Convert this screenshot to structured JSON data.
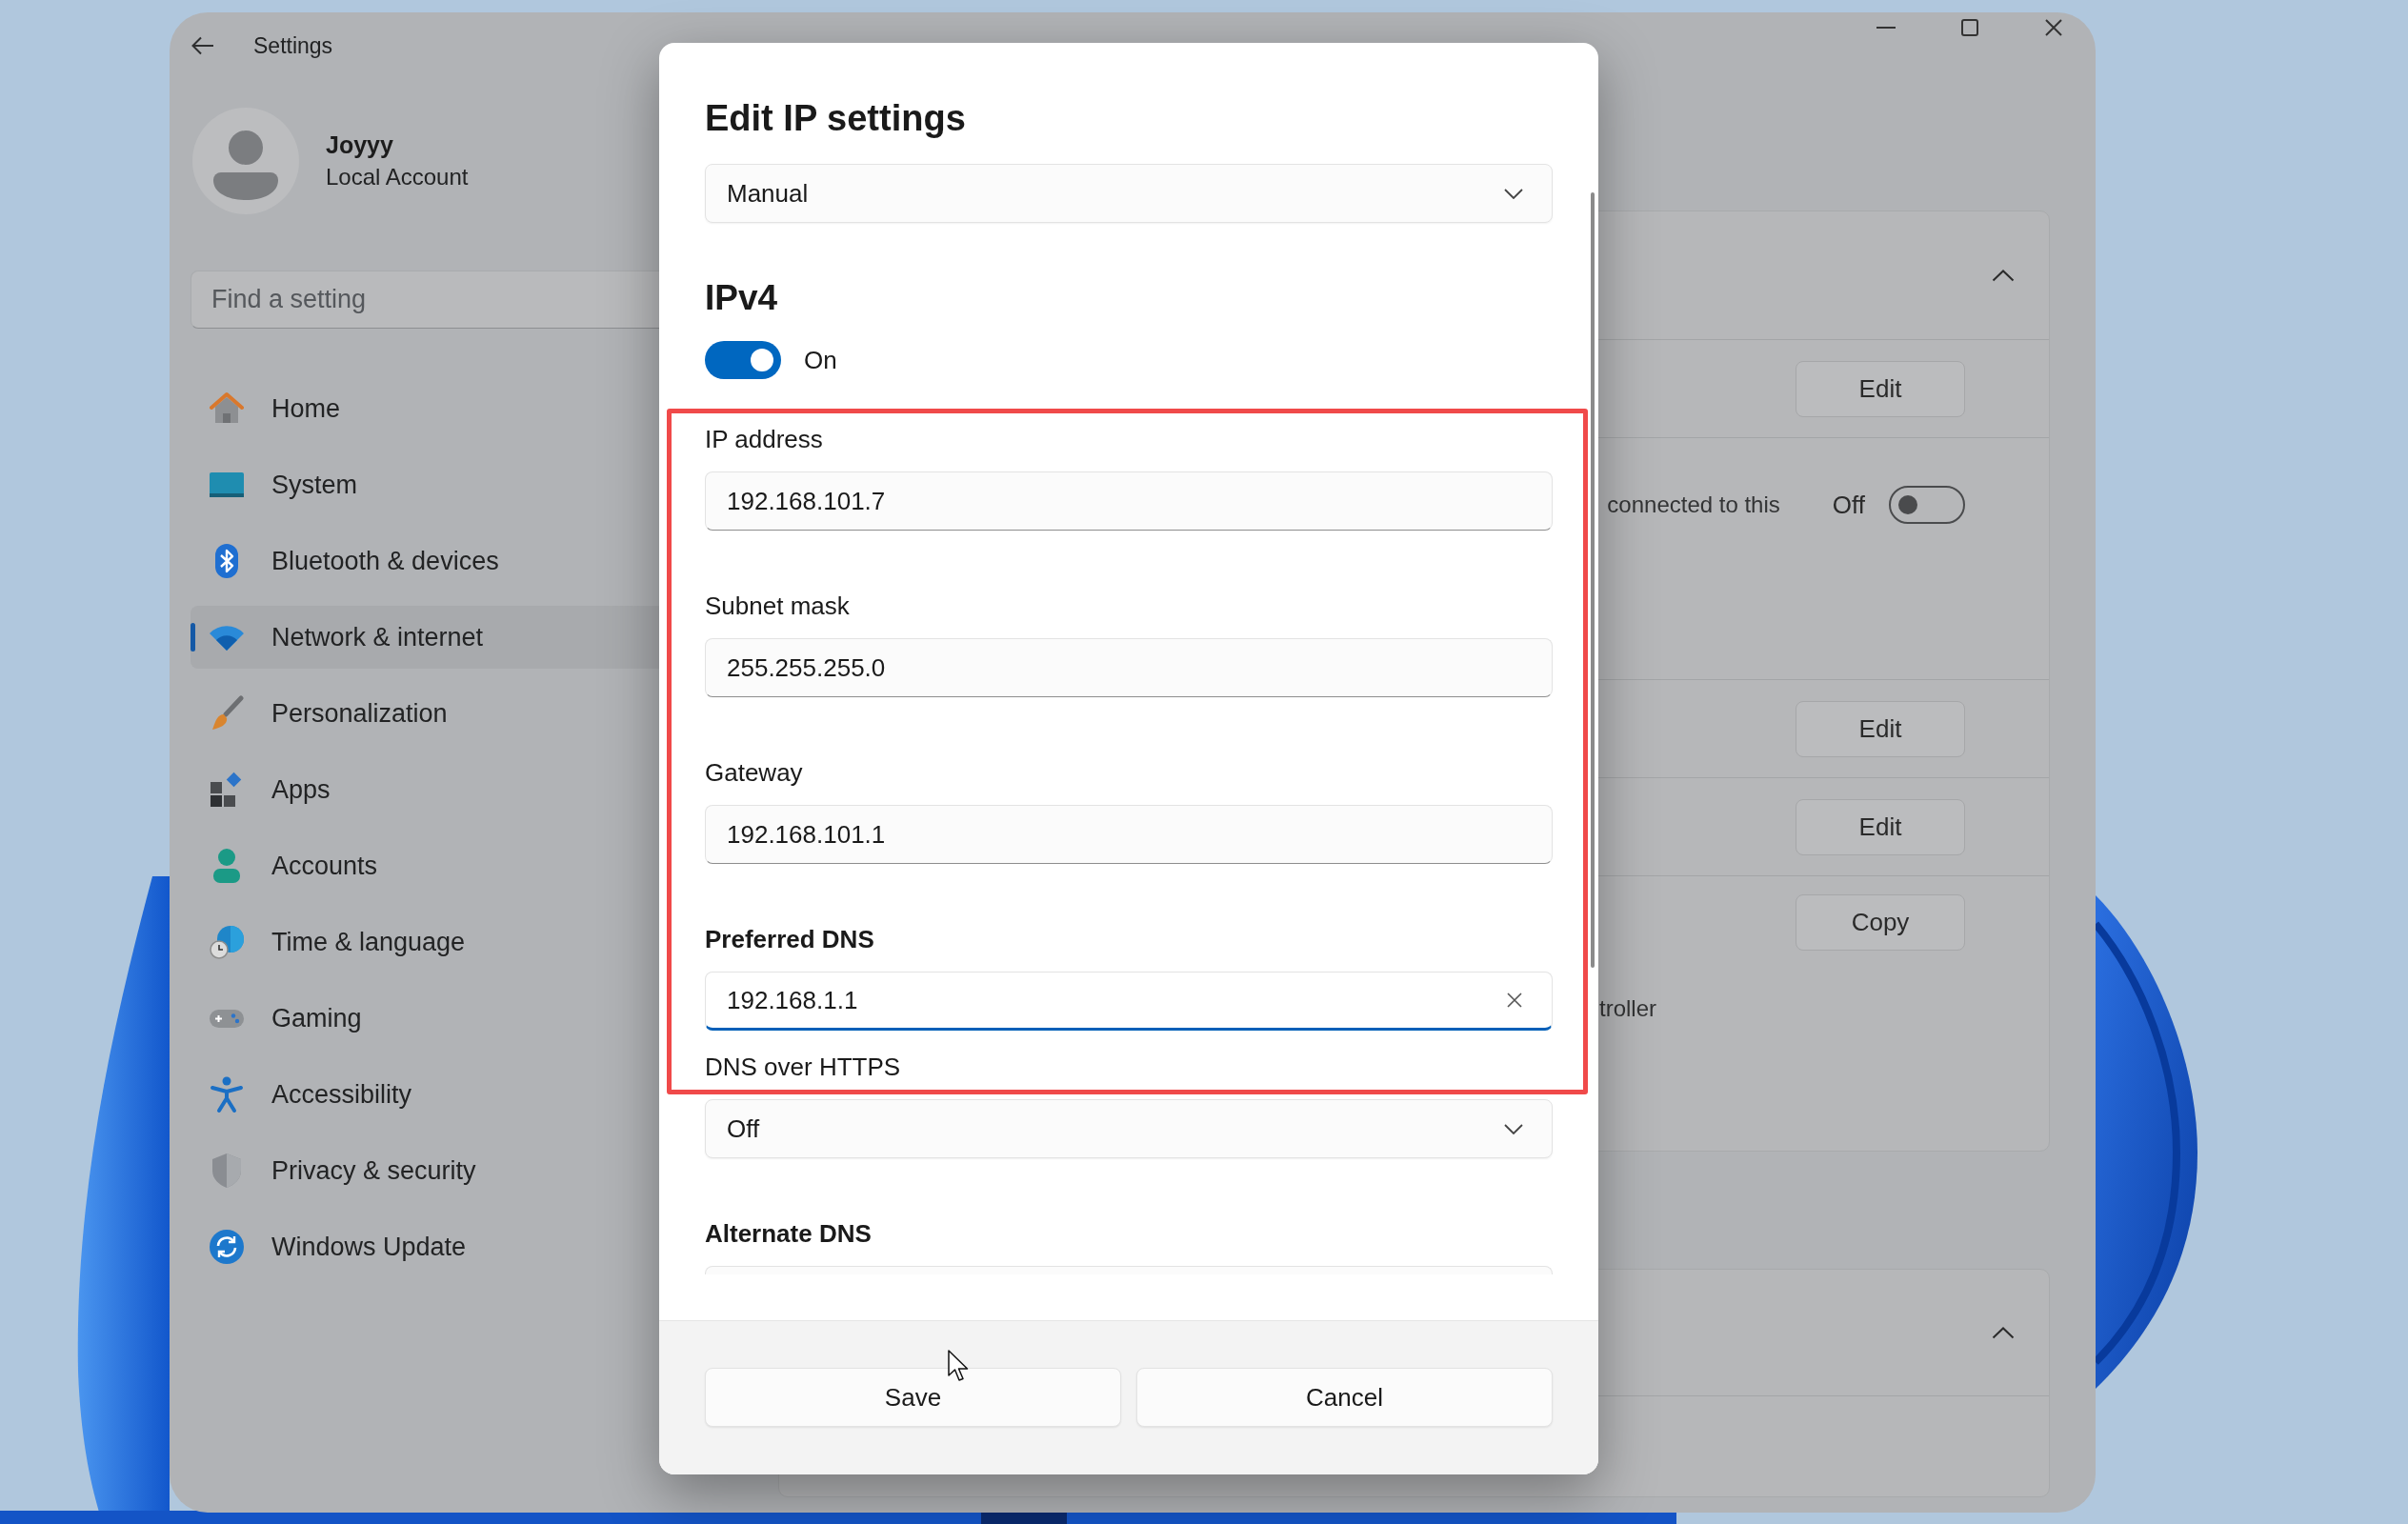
{
  "window": {
    "title": "Settings"
  },
  "profile": {
    "name": "Joyyy",
    "account_type": "Local Account"
  },
  "search": {
    "placeholder": "Find a setting"
  },
  "sidebar": {
    "items": [
      {
        "label": "Home",
        "selected": false
      },
      {
        "label": "System",
        "selected": false
      },
      {
        "label": "Bluetooth & devices",
        "selected": false
      },
      {
        "label": "Network & internet",
        "selected": true
      },
      {
        "label": "Personalization",
        "selected": false
      },
      {
        "label": "Apps",
        "selected": false
      },
      {
        "label": "Accounts",
        "selected": false
      },
      {
        "label": "Time & language",
        "selected": false
      },
      {
        "label": "Gaming",
        "selected": false
      },
      {
        "label": "Accessibility",
        "selected": false
      },
      {
        "label": "Privacy & security",
        "selected": false
      },
      {
        "label": "Windows Update",
        "selected": false
      }
    ]
  },
  "page": {
    "cards": [
      {
        "expanded": true,
        "rows": [
          {
            "kind": "button",
            "button": "Edit"
          },
          {
            "kind": "toggle",
            "text": "connected to this",
            "state_label": "Off",
            "on": false
          },
          {
            "kind": "button",
            "button": "Edit"
          },
          {
            "kind": "button",
            "button": "Edit"
          },
          {
            "kind": "property",
            "button": "Copy",
            "text": "troller"
          }
        ]
      },
      {
        "expanded": true,
        "rows": [
          {
            "kind": "blank"
          }
        ]
      }
    ]
  },
  "dialog": {
    "title": "Edit IP settings",
    "mode": {
      "value": "Manual"
    },
    "section_title": "IPv4",
    "ipv4_toggle": {
      "on": true,
      "state_label": "On"
    },
    "fields": [
      {
        "kind": "text",
        "label": "IP address",
        "emphasized": false,
        "value": "192.168.101.7",
        "focused": false
      },
      {
        "kind": "text",
        "label": "Subnet mask",
        "emphasized": false,
        "value": "255.255.255.0",
        "focused": false
      },
      {
        "kind": "text",
        "label": "Gateway",
        "emphasized": false,
        "value": "192.168.101.1",
        "focused": false
      },
      {
        "kind": "text",
        "label": "Preferred DNS",
        "emphasized": true,
        "value": "192.168.1.1",
        "focused": true
      },
      {
        "kind": "select",
        "label": "DNS over HTTPS",
        "emphasized": false,
        "value": "Off"
      },
      {
        "kind": "text",
        "label": "Alternate DNS",
        "emphasized": true,
        "focused": false
      }
    ],
    "buttons": [
      {
        "label": "Save"
      },
      {
        "label": "Cancel"
      }
    ]
  },
  "annotation": {
    "kind": "highlight_frame"
  }
}
